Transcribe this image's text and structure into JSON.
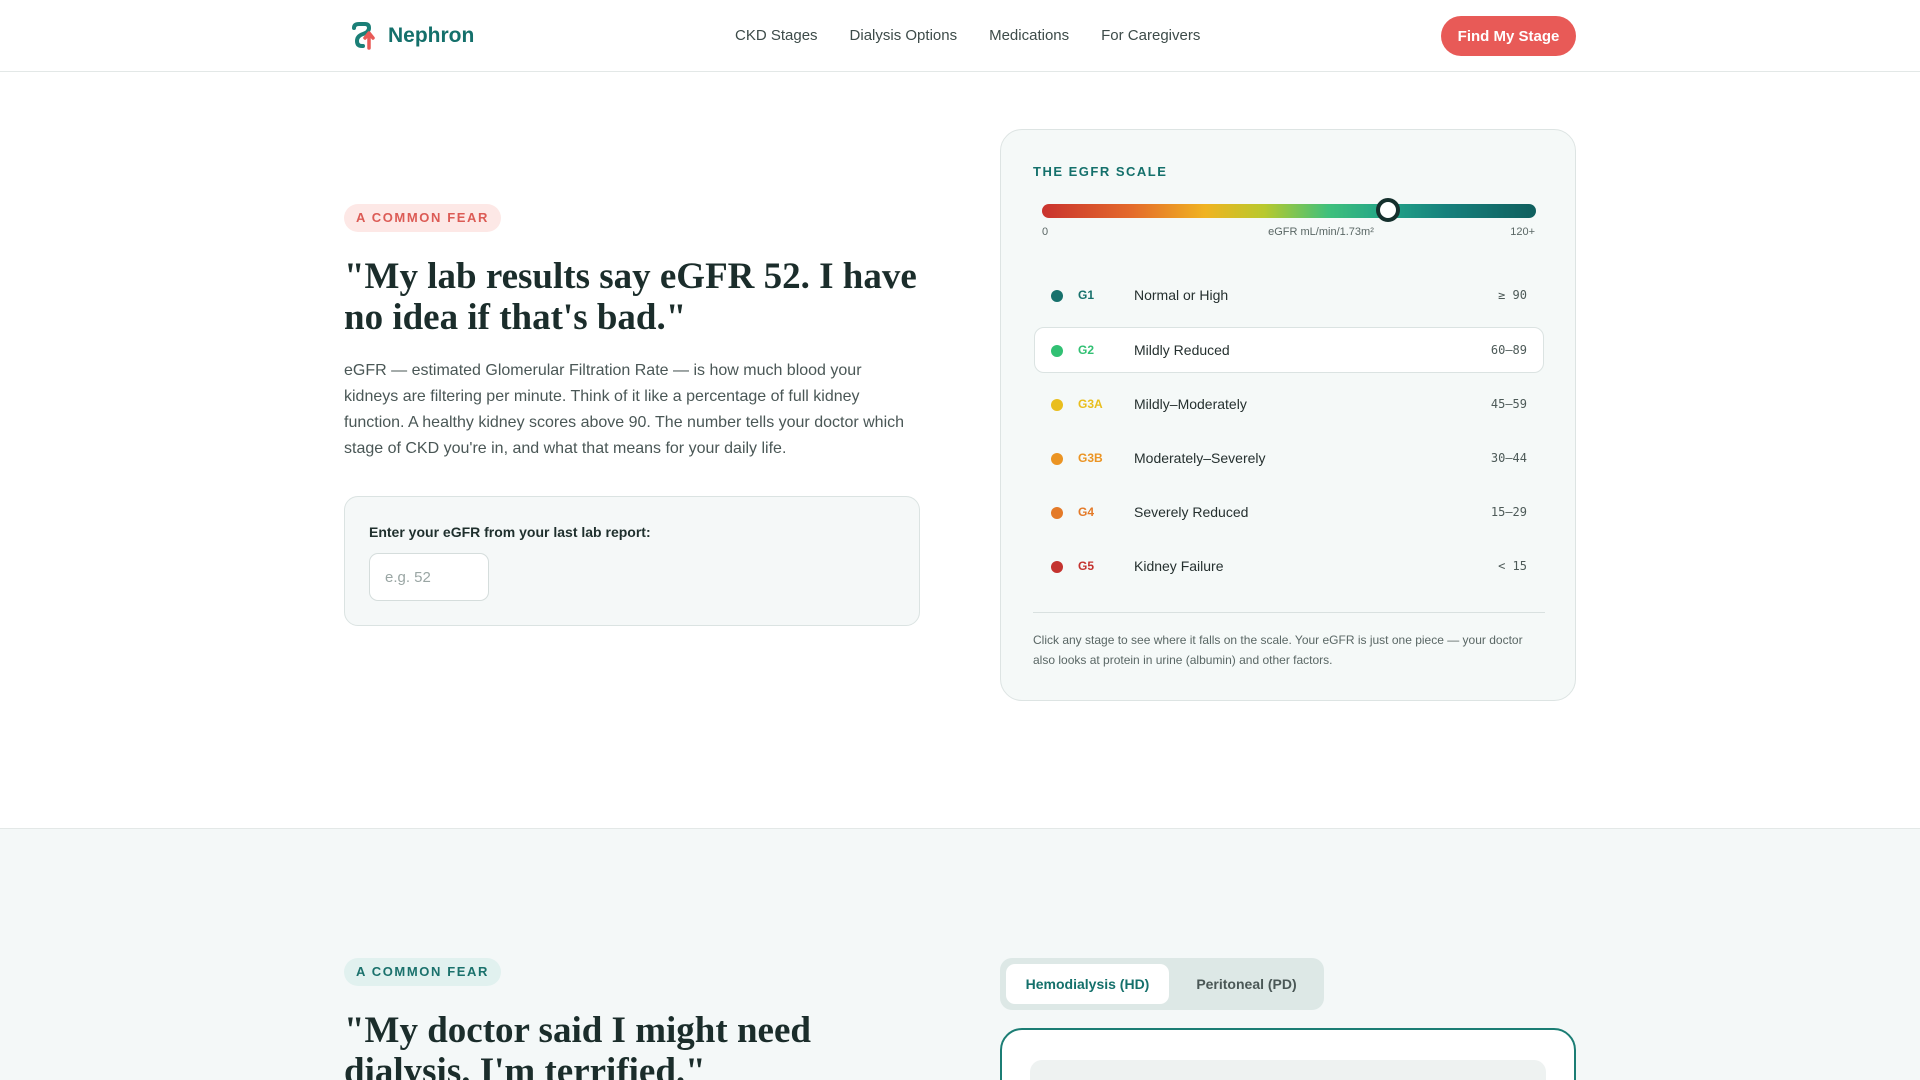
{
  "header": {
    "brand": "Nephron",
    "nav": [
      "CKD Stages",
      "Dialysis Options",
      "Medications",
      "For Caregivers"
    ],
    "cta": "Find My Stage"
  },
  "hero": {
    "badge": "A COMMON FEAR",
    "headline": "\"My lab results say eGFR 52. I have no idea if that's bad.\"",
    "lead": "eGFR — estimated Glomerular Filtration Rate — is how much blood your kidneys are filtering per minute. Think of it like a percentage of full kidney function. A healthy kidney scores above 90. The number tells your doctor which stage of CKD you're in, and what that means for your daily life.",
    "input_label": "Enter your eGFR from your last lab report:",
    "input_placeholder": "e.g. 52",
    "input_value": ""
  },
  "scale": {
    "title": "THE EGFR SCALE",
    "min_label": "0",
    "unit_label": "eGFR mL/min/1.73m²",
    "max_label": "120+",
    "min": 0,
    "max": 120,
    "thumb_value": 84,
    "stages": [
      {
        "code": "G1",
        "name": "Normal or High",
        "range": "≥ 90",
        "color": "#17716c"
      },
      {
        "code": "G2",
        "name": "Mildly Reduced",
        "range": "60–89",
        "color": "#31c073",
        "active": true
      },
      {
        "code": "G3A",
        "name": "Mildly–Moderately",
        "range": "45–59",
        "color": "#e9be1d"
      },
      {
        "code": "G3B",
        "name": "Moderately–Severely",
        "range": "30–44",
        "color": "#eb9423"
      },
      {
        "code": "G4",
        "name": "Severely Reduced",
        "range": "15–29",
        "color": "#e47a28"
      },
      {
        "code": "G5",
        "name": "Kidney Failure",
        "range": "< 15",
        "color": "#c4332f"
      }
    ],
    "note": "Click any stage to see where it falls on the scale. Your eGFR is just one piece — your doctor also looks at protein in urine (albumin) and other factors."
  },
  "dialysis": {
    "badge": "A COMMON FEAR",
    "headline": "\"My doctor said I might need dialysis. I'm terrified.\"",
    "tabs": [
      "Hemodialysis (HD)",
      "Peritoneal (PD)"
    ]
  },
  "colors": {
    "brand": "#14706b",
    "cta": "#e85a57"
  }
}
